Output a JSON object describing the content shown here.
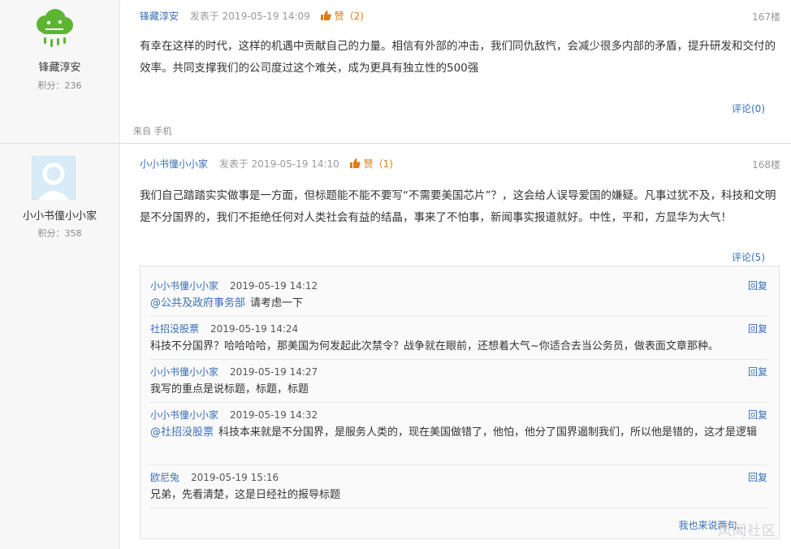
{
  "posts": [
    {
      "author": "锋藏淳安",
      "score": "积分：236",
      "posted": "发表于 2019-05-19 14:09",
      "likes": "赞（2)",
      "floor": "167楼",
      "content": "有幸在这样的时代，这样的机遇中贡献自己的力量。相信有外部的冲击，我们同仇敌忾，会减少很多内部的矛盾，提升研发和交付的效率。共同支撑我们的公司度过这个难关，成为更具有独立性的500强",
      "comments": "评论(0)",
      "device": "来自 手机",
      "avatar": "green-cloud-logo"
    },
    {
      "author": "小小书僮小小家",
      "score": "积分：358",
      "posted": "发表于 2019-05-19 14:10",
      "likes": "赞（1)",
      "floor": "168楼",
      "content": "我们自己踏踏实实做事是一方面，但标题能不能不要写“不需要美国芯片”？，这会给人误导爱国的嫌疑。凡事过犹不及，科技和文明是不分国界的，我们不拒绝任何对人类社会有益的结晶，事来了不怕事，新闻事实报道就好。中性，平和，方显华为大气！",
      "comments": "评论(5)",
      "avatar": "default-user-avatar"
    }
  ],
  "replies": [
    {
      "user": "小小书僮小小家",
      "time": "2019-05-19 14:12",
      "mention": "@公共及政府事务部",
      "text": "请考虑一下",
      "reply": "回复"
    },
    {
      "user": "社招没股票",
      "time": "2019-05-19 14:24",
      "mention": "",
      "text": "科技不分国界？哈哈哈哈，那美国为何发起此次禁令？战争就在眼前，还想着大气~你适合去当公务员，做表面文章那种。",
      "reply": "回复"
    },
    {
      "user": "小小书僮小小家",
      "time": "2019-05-19 14:27",
      "mention": "",
      "text": "我写的重点是说标题，标题，标题",
      "reply": "回复"
    },
    {
      "user": "小小书僮小小家",
      "time": "2019-05-19 14:32",
      "mention": "@社招没股票",
      "text": "科技本来就是不分国界，是服务人类的，现在美国做错了，他怕，他分了国界遏制我们，所以他是错的，这才是逻辑",
      "reply": "回复"
    },
    {
      "user": "欧尼兔",
      "time": "2019-05-19 15:16",
      "mention": "",
      "text": "兄弟，先看清楚，这是日经社的报导标题",
      "reply": "回复"
    }
  ],
  "say_link": "我也来说两句...",
  "watermark": "风闻社区",
  "colors": {
    "link": "#3a6fb8",
    "like": "#e07a17",
    "sidebar": "#f7f7f7"
  }
}
